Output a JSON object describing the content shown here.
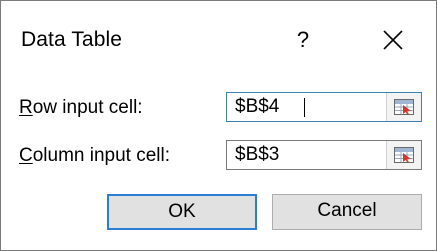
{
  "dialog": {
    "title": "Data Table",
    "help_label": "?",
    "row_input": {
      "label_accel": "R",
      "label_rest": "ow input cell:",
      "value": "$B$4"
    },
    "column_input": {
      "label_accel": "C",
      "label_rest": "olumn input cell:",
      "value": "$B$3"
    },
    "ok_label": "OK",
    "cancel_label": "Cancel"
  },
  "icons": {
    "close": "close-icon",
    "range_picker": "collapse-dialog-icon"
  },
  "colors": {
    "focus_border": "#2a7fd3",
    "active_field_border": "#3c7fb1",
    "button_face": "#e1e1e1"
  }
}
